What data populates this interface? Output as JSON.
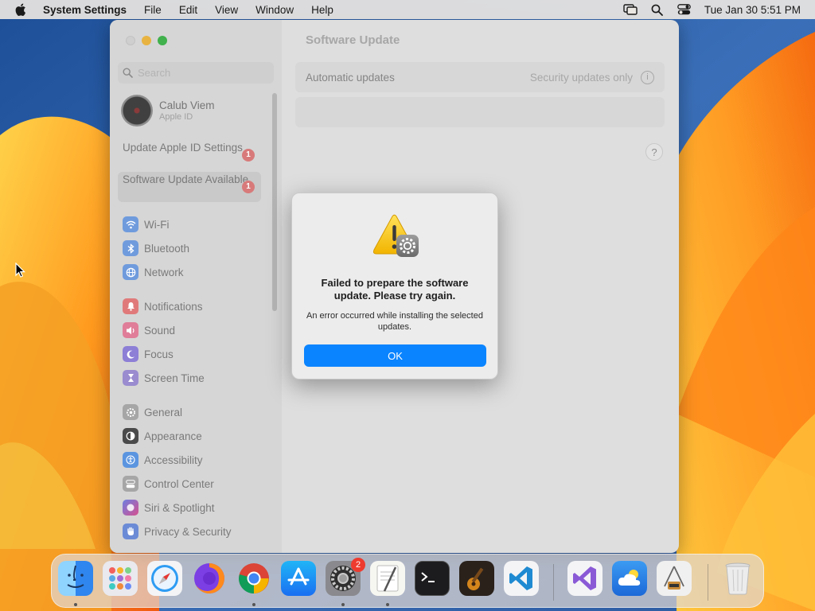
{
  "menubar": {
    "app_name": "System Settings",
    "menus": [
      "File",
      "Edit",
      "View",
      "Window",
      "Help"
    ],
    "clock": "Tue Jan 30  5:51 PM"
  },
  "window": {
    "title": "Software Update",
    "search": {
      "placeholder": "Search"
    },
    "account": {
      "name": "Calub Viem",
      "subtitle": "Apple ID"
    },
    "notices": [
      {
        "label": "Update Apple ID Settings",
        "badge": "1"
      },
      {
        "label": "Software Update Available",
        "badge": "1"
      }
    ],
    "sidebar_items": [
      {
        "label": "Wi-Fi",
        "icon": "wifi-icon",
        "color": "#5b8ed6"
      },
      {
        "label": "Bluetooth",
        "icon": "bluetooth-icon",
        "color": "#5b8ed6"
      },
      {
        "label": "Network",
        "icon": "globe-icon",
        "color": "#5b8ed6"
      },
      {
        "label": "Notifications",
        "icon": "bell-icon",
        "color": "#d86a6a"
      },
      {
        "label": "Sound",
        "icon": "speaker-icon",
        "color": "#d86a8a"
      },
      {
        "label": "Focus",
        "icon": "moon-icon",
        "color": "#7f6bd0"
      },
      {
        "label": "Screen Time",
        "icon": "hourglass-icon",
        "color": "#8f7dc9"
      },
      {
        "label": "General",
        "icon": "gear-icon",
        "color": "#9a9a9a"
      },
      {
        "label": "Appearance",
        "icon": "appearance-icon",
        "color": "#3a3a3a"
      },
      {
        "label": "Accessibility",
        "icon": "accessibility-icon",
        "color": "#4f8ede"
      },
      {
        "label": "Control Center",
        "icon": "control-center-icon",
        "color": "#9a9a9a"
      },
      {
        "label": "Siri & Spotlight",
        "icon": "siri-icon",
        "color": "#c0569f"
      },
      {
        "label": "Privacy & Security",
        "icon": "hand-icon",
        "color": "#5a7fd0"
      }
    ],
    "automatic_updates": {
      "label": "Automatic updates",
      "value": "Security updates only"
    },
    "help_label": "?"
  },
  "dialog": {
    "heading": "Failed to prepare the software update. Please try again.",
    "message": "An error occurred while installing the selected updates.",
    "ok_label": "OK"
  },
  "dock": {
    "apps": [
      "finder",
      "launchpad",
      "safari",
      "firefox",
      "chrome",
      "app-store",
      "system-settings",
      "textedit",
      "terminal",
      "garageband",
      "vscode",
      "visual-studio",
      "weather",
      "installer",
      "trash"
    ],
    "system_settings_badge": "2"
  }
}
